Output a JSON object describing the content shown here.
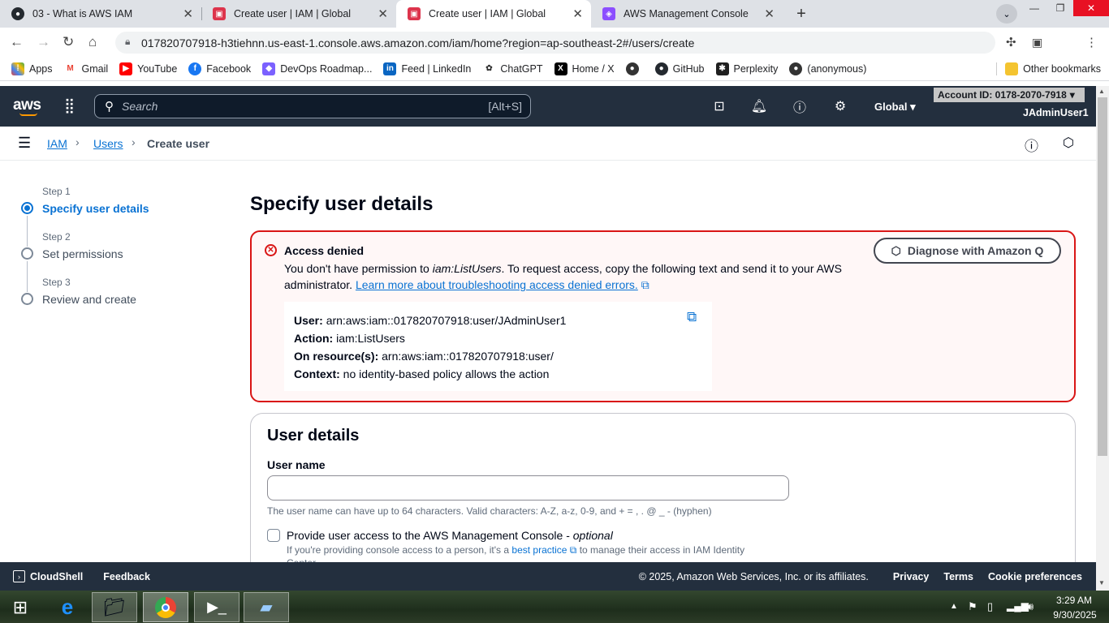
{
  "browser": {
    "tabs": [
      {
        "title": "03 - What is AWS IAM",
        "icon": "github-icon"
      },
      {
        "title": "Create user | IAM | Global",
        "icon": "aws-iam-icon"
      },
      {
        "title": "Create user | IAM | Global",
        "icon": "aws-iam-icon"
      },
      {
        "title": "AWS Management Console",
        "icon": "aws-cube-icon"
      }
    ],
    "url": "017820707918-h3tiehnn.us-east-1.console.aws.amazon.com/iam/home?region=ap-southeast-2#/users/create",
    "bookmarks": [
      "Apps",
      "Gmail",
      "YouTube",
      "Facebook",
      "DevOps Roadmap...",
      "Feed | LinkedIn",
      "ChatGPT",
      "Home / X",
      "GitHub",
      "Perplexity",
      "(anonymous)"
    ],
    "other_bookmarks": "Other bookmarks"
  },
  "aws": {
    "logo": "aws",
    "search_placeholder": "Search",
    "search_shortcut": "[Alt+S]",
    "region": "Global",
    "account": "Account ID: 0178-2070-7918",
    "user": "JAdminUser1"
  },
  "breadcrumb": [
    "IAM",
    "Users",
    "Create user"
  ],
  "steps": [
    {
      "step": "Step 1",
      "name": "Specify user details"
    },
    {
      "step": "Step 2",
      "name": "Set permissions"
    },
    {
      "step": "Step 3",
      "name": "Review and create"
    }
  ],
  "page_title": "Specify user details",
  "alert": {
    "title": "Access denied",
    "msg_pre": "You don't have permission to ",
    "msg_action": "iam:ListUsers",
    "msg_post": ". To request access, copy the following text and send it to your AWS",
    "msg_line2": "administrator.",
    "link": "Learn more about troubleshooting access denied errors.",
    "diag_button": "Diagnose with Amazon Q",
    "details": [
      {
        "label": "User:",
        "value": "arn:aws:iam::017820707918:user/JAdminUser1"
      },
      {
        "label": "Action:",
        "value": "iam:ListUsers"
      },
      {
        "label": "On resource(s):",
        "value": "arn:aws:iam::017820707918:user/"
      },
      {
        "label": "Context:",
        "value": "no identity-based policy allows the action"
      }
    ]
  },
  "user_details": {
    "heading": "User details",
    "username_label": "User name",
    "username_value": "",
    "username_hint": "The user name can have up to 64 characters. Valid characters: A-Z, a-z, 0-9, and + = , . @ _ - (hyphen)",
    "console_access_label": "Provide user access to the AWS Management Console - ",
    "console_access_optional": "optional",
    "console_hint_pre": "If you're providing console access to a person, it's a ",
    "console_hint_link": "best practice",
    "console_hint_post": " to manage their access in IAM Identity",
    "console_hint_cut": "Center."
  },
  "footer": {
    "cloudshell": "CloudShell",
    "feedback": "Feedback",
    "copyright": "© 2025, Amazon Web Services, Inc. or its affiliates.",
    "links": [
      "Privacy",
      "Terms",
      "Cookie preferences"
    ]
  },
  "taskbar": {
    "time": "3:29 AM",
    "date": "9/30/2025"
  },
  "colors": {
    "aws_nav": "#232f3e",
    "link": "#0972d3",
    "error": "#d91515",
    "active_step": "#0972d3"
  }
}
